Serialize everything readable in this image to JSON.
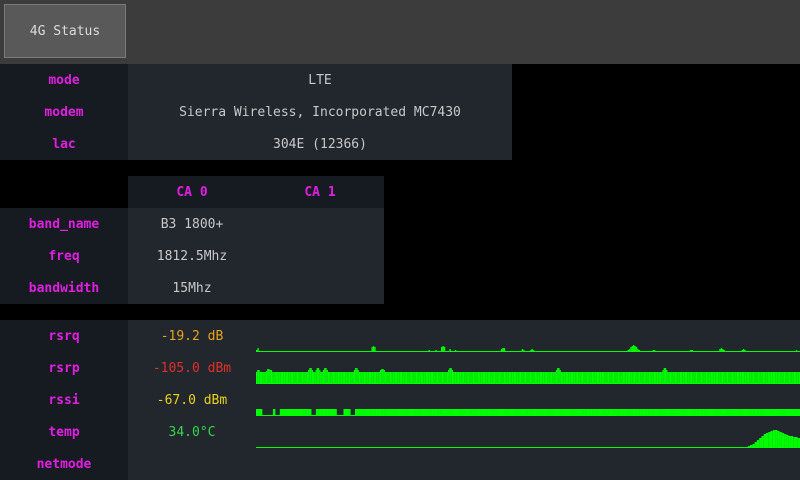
{
  "tab": {
    "label": "4G Status"
  },
  "info": {
    "mode": {
      "key": "mode",
      "value": "LTE"
    },
    "modem": {
      "key": "modem",
      "value": "Sierra Wireless, Incorporated MC7430"
    },
    "lac": {
      "key": "lac",
      "value": "304E (12366)"
    }
  },
  "ca": {
    "headers": [
      "CA 0",
      "CA 1"
    ],
    "rows": [
      {
        "key": "band_name",
        "ca0": "B3 1800+",
        "ca1": ""
      },
      {
        "key": "freq",
        "ca0": "1812.5Mhz",
        "ca1": ""
      },
      {
        "key": "bandwidth",
        "ca0": "15Mhz",
        "ca1": ""
      }
    ]
  },
  "signal": {
    "rsrq": {
      "key": "rsrq",
      "value": "-19.2 dB",
      "color": "#e8a31a"
    },
    "rsrp": {
      "key": "rsrp",
      "value": "-105.0 dBm",
      "color": "#e0302a"
    },
    "rssi": {
      "key": "rssi",
      "value": "-67.0 dBm",
      "color": "#e8d21a"
    },
    "temp": {
      "key": "temp",
      "value": "34.0°C",
      "color": "#36d648"
    },
    "netmode": {
      "key": "netmode",
      "value": ""
    }
  },
  "graph_color": "#00ff00",
  "history": {
    "rsrq": [
      2,
      4,
      1,
      0,
      0,
      0,
      0,
      0,
      0,
      0,
      0,
      0,
      0,
      1,
      0,
      0,
      0,
      0,
      0,
      0,
      0,
      0,
      0,
      0,
      0,
      0,
      0,
      0,
      0,
      0,
      0,
      0,
      0,
      0,
      0,
      0,
      1,
      0,
      0,
      0,
      0,
      0,
      0,
      0,
      0,
      0,
      0,
      0,
      1,
      0,
      0,
      0,
      0,
      0,
      0,
      0,
      0,
      0,
      0,
      0,
      0,
      0,
      0,
      0,
      0,
      0,
      0,
      1,
      0,
      0,
      0,
      0,
      0,
      0,
      0,
      0,
      0,
      0,
      0,
      0,
      0,
      0,
      0,
      5,
      6,
      5,
      0,
      0,
      0,
      0,
      0,
      0,
      1,
      0,
      0,
      0,
      0,
      0,
      0,
      0,
      0,
      0,
      0,
      0,
      0,
      1,
      0,
      0,
      0,
      0,
      0,
      0,
      0,
      0,
      0,
      0,
      0,
      0,
      0,
      0,
      0,
      0,
      0,
      0,
      2,
      0,
      0,
      0,
      0,
      2,
      1,
      0,
      0,
      5,
      6,
      5,
      0,
      0,
      0,
      3,
      0,
      0,
      0,
      2,
      1,
      0,
      0,
      0,
      0,
      0,
      0,
      0,
      0,
      0,
      0,
      0,
      0,
      1,
      1,
      1,
      0,
      0,
      0,
      0,
      0,
      0,
      0,
      0,
      0,
      0,
      0,
      0,
      0,
      0,
      0,
      0,
      3,
      4,
      4,
      1,
      0,
      0,
      0,
      0,
      0,
      1,
      0,
      0,
      0,
      0,
      0,
      3,
      2,
      1,
      0,
      0,
      0,
      2,
      3,
      2,
      1,
      0,
      0,
      0,
      1,
      0,
      0,
      0,
      0,
      0,
      0,
      0,
      0,
      0,
      0,
      0,
      0,
      0,
      0,
      0,
      0,
      0,
      0,
      0,
      0,
      0,
      0,
      0,
      0,
      0,
      0,
      0,
      0,
      0,
      0,
      0,
      0,
      0,
      0,
      0,
      0,
      0,
      0,
      0,
      0,
      0,
      0,
      0,
      0,
      0,
      0,
      0,
      0,
      0,
      0,
      0,
      0,
      0,
      0,
      0,
      0,
      0,
      0,
      0,
      0,
      1,
      1,
      2,
      3,
      5,
      6,
      7,
      6,
      5,
      3,
      2,
      1,
      0,
      0,
      0,
      0,
      0,
      0,
      0,
      0,
      2,
      2,
      1,
      0,
      0,
      0,
      0,
      0,
      0,
      0,
      0,
      0,
      0,
      0,
      0,
      0,
      0,
      0,
      0,
      0,
      0,
      0,
      0,
      0,
      0,
      0,
      1,
      2,
      2,
      1,
      0,
      0,
      0,
      0,
      0,
      0,
      0,
      0,
      0,
      1,
      0,
      0,
      0,
      0,
      0,
      0,
      0,
      0,
      3,
      4,
      3,
      2,
      1,
      0,
      0,
      0,
      0,
      0,
      0,
      0,
      0,
      0,
      0,
      0,
      2,
      3,
      2,
      1,
      0,
      0,
      0,
      0,
      0,
      0,
      0,
      0,
      0,
      0,
      0,
      0,
      0,
      0,
      0,
      0,
      0,
      0,
      0,
      0,
      0,
      0,
      0,
      0,
      0,
      0,
      0,
      0,
      0,
      0,
      0,
      0,
      0,
      0,
      1,
      2,
      1,
      0
    ],
    "rsrp": [
      12,
      14,
      14,
      12,
      12,
      12,
      12,
      12,
      13,
      15,
      15,
      14,
      14,
      12,
      12,
      12,
      12,
      12,
      12,
      12,
      12,
      12,
      12,
      12,
      12,
      12,
      12,
      12,
      12,
      12,
      12,
      12,
      12,
      12,
      12,
      12,
      12,
      12,
      12,
      12,
      12,
      12,
      14,
      16,
      16,
      14,
      12,
      12,
      14,
      16,
      16,
      14,
      12,
      12,
      14,
      16,
      16,
      14,
      12,
      12,
      12,
      12,
      12,
      12,
      12,
      12,
      12,
      12,
      12,
      12,
      12,
      12,
      12,
      12,
      12,
      12,
      12,
      12,
      12,
      14,
      16,
      16,
      14,
      12,
      12,
      12,
      12,
      12,
      12,
      12,
      12,
      12,
      12,
      12,
      12,
      12,
      12,
      12,
      12,
      12,
      14,
      15,
      15,
      14,
      12,
      12,
      12,
      12,
      12,
      12,
      12,
      12,
      12,
      12,
      12,
      12,
      12,
      12,
      12,
      12,
      12,
      12,
      12,
      12,
      12,
      12,
      12,
      12,
      12,
      12,
      12,
      12,
      12,
      12,
      12,
      12,
      12,
      12,
      12,
      12,
      12,
      12,
      12,
      12,
      12,
      12,
      12,
      12,
      12,
      12,
      12,
      12,
      12,
      12,
      12,
      14,
      16,
      16,
      14,
      12,
      12,
      12,
      12,
      12,
      12,
      12,
      12,
      12,
      12,
      12,
      12,
      12,
      12,
      12,
      12,
      12,
      12,
      12,
      12,
      12,
      12,
      12,
      12,
      12,
      12,
      12,
      12,
      12,
      12,
      12,
      12,
      12,
      12,
      12,
      12,
      12,
      12,
      12,
      12,
      12,
      12,
      12,
      12,
      12,
      12,
      12,
      12,
      12,
      12,
      12,
      12,
      12,
      12,
      12,
      12,
      12,
      12,
      12,
      12,
      12,
      12,
      12,
      12,
      12,
      12,
      12,
      12,
      12,
      12,
      12,
      12,
      12,
      12,
      12,
      12,
      12,
      12,
      12,
      12,
      12,
      12,
      12,
      14,
      16,
      16,
      14,
      12,
      12,
      12,
      12,
      12,
      12,
      12,
      12,
      12,
      12,
      12,
      12,
      12,
      12,
      12,
      12,
      12,
      12,
      12,
      12,
      12,
      12,
      12,
      12,
      12,
      12,
      12,
      12,
      12,
      12,
      12,
      12,
      12,
      12,
      12,
      12,
      12,
      12,
      12,
      12,
      12,
      12,
      12,
      12,
      12,
      12,
      12,
      12,
      12,
      12,
      12,
      12,
      12,
      12,
      12,
      12,
      12,
      12,
      12,
      12,
      12,
      12,
      12,
      12,
      12,
      12,
      12,
      12,
      12,
      12,
      12,
      12,
      12,
      12,
      12,
      12,
      12,
      12,
      12,
      12,
      12,
      12,
      14,
      16,
      16,
      14,
      12,
      12,
      12,
      12,
      12,
      12,
      12,
      12,
      12,
      12,
      12,
      12,
      12,
      12,
      12,
      12,
      12,
      12,
      12,
      12,
      12,
      12,
      12,
      12,
      12,
      12,
      12,
      12,
      12,
      12,
      12,
      12,
      12,
      12,
      12,
      12,
      12,
      12,
      12,
      12,
      12,
      12,
      12,
      12,
      12,
      12,
      12,
      12,
      12,
      12,
      12,
      12,
      12,
      12,
      12,
      12,
      12,
      12,
      12,
      12,
      12,
      12,
      12,
      12,
      12,
      12,
      12,
      12,
      12,
      12,
      12,
      12,
      12,
      12,
      12,
      12,
      12,
      12,
      12,
      12,
      12,
      12,
      12,
      12,
      12,
      12,
      12,
      12,
      12,
      12,
      12,
      12,
      12,
      12,
      12,
      12,
      12,
      12,
      12,
      12,
      12,
      12,
      12,
      12,
      12,
      12,
      12
    ],
    "rssi": [
      7,
      7,
      7,
      7,
      7,
      7,
      7,
      7,
      1,
      1,
      1,
      1,
      1,
      1,
      1,
      1,
      1,
      1,
      1,
      1,
      1,
      1,
      7,
      7,
      7,
      1,
      1,
      1,
      1,
      1,
      1,
      7,
      7,
      7,
      7,
      7,
      7,
      7,
      7,
      7,
      7,
      7,
      7,
      7,
      7,
      7,
      7,
      7,
      7,
      7,
      7,
      7,
      7,
      7,
      7,
      7,
      7,
      7,
      7,
      7,
      7,
      7,
      7,
      7,
      7,
      7,
      7,
      7,
      7,
      7,
      7,
      7,
      1,
      1,
      1,
      1,
      1,
      1,
      7,
      7,
      7,
      7,
      7,
      7,
      7,
      7,
      7,
      7,
      7,
      7,
      7,
      7,
      7,
      7,
      7,
      7,
      7,
      7,
      7,
      7,
      7,
      7,
      7,
      7,
      7,
      1,
      1,
      1,
      1,
      1,
      1,
      1,
      1,
      1,
      7,
      7,
      7,
      7,
      7,
      7,
      7,
      7,
      7,
      1,
      1,
      1,
      1,
      1,
      1,
      7,
      7,
      7,
      7,
      7,
      7,
      7,
      7,
      7,
      7,
      7,
      7,
      7,
      7,
      7,
      7,
      7,
      7,
      7,
      7,
      7,
      7,
      7,
      7,
      7,
      7,
      7,
      7,
      7,
      7,
      7,
      7,
      7,
      7,
      7,
      7,
      7,
      7,
      7,
      7,
      7,
      7,
      7,
      7,
      7,
      7,
      7,
      7,
      7,
      7,
      7,
      7,
      7,
      7,
      7,
      7,
      7,
      7,
      7,
      7,
      7,
      7,
      7,
      7,
      7,
      7,
      7,
      7,
      7,
      7,
      7,
      7,
      7,
      7,
      7,
      7,
      7,
      7,
      7,
      7,
      7,
      7,
      7,
      7,
      7,
      7,
      7,
      7,
      7,
      7,
      7,
      7,
      7,
      7,
      7,
      7,
      7,
      7,
      7,
      7,
      7,
      7,
      7,
      7,
      7,
      7,
      7,
      7,
      7,
      7,
      7,
      7,
      7,
      7,
      7,
      7,
      7,
      7,
      7,
      7,
      7,
      7,
      7,
      7,
      7,
      7,
      7,
      7,
      7,
      7,
      7,
      7,
      7,
      7,
      7,
      7,
      7,
      7,
      7,
      7,
      7,
      7,
      7,
      7,
      7,
      7,
      7,
      7,
      7,
      7,
      7,
      7,
      7,
      7,
      7,
      7,
      7,
      7,
      7,
      7,
      7,
      7,
      7,
      7,
      7,
      7,
      7,
      7,
      7,
      7,
      7,
      7,
      7,
      7,
      7,
      7,
      7,
      7,
      7,
      7,
      7,
      7,
      7,
      7,
      7,
      7,
      7,
      7,
      7,
      7,
      7,
      7,
      7,
      7,
      7,
      7,
      7,
      7,
      7,
      7,
      7,
      7,
      7,
      7,
      7,
      7,
      7,
      7,
      7,
      7,
      7,
      7,
      7,
      7,
      7,
      7,
      7,
      7,
      7,
      7,
      7,
      7,
      7,
      7,
      7,
      7,
      7,
      7,
      7,
      7,
      7,
      7,
      7,
      7,
      7,
      7,
      7,
      7,
      7,
      7,
      7,
      7,
      7,
      7,
      7,
      7,
      7,
      7,
      7,
      7,
      7,
      7,
      7,
      7,
      7,
      7,
      7,
      7,
      7,
      7,
      7,
      7,
      7,
      7,
      7,
      7,
      7,
      7,
      7,
      7,
      7,
      7,
      7,
      7,
      7,
      7,
      7,
      7,
      7,
      7,
      7,
      7,
      7,
      7,
      7,
      7,
      7,
      7,
      7,
      7,
      7,
      7,
      7,
      7,
      7,
      7,
      7,
      7,
      7,
      7,
      7,
      7,
      7,
      7,
      7,
      7,
      7,
      7,
      7,
      7,
      7,
      7,
      7,
      7,
      7,
      7,
      7,
      7,
      7,
      7,
      7,
      7,
      7,
      7,
      7,
      7,
      7,
      7,
      7,
      7,
      7,
      7,
      7,
      7,
      7,
      7,
      7,
      7,
      7,
      7,
      7,
      7,
      7,
      7,
      7,
      7,
      7,
      7,
      7,
      7,
      7,
      7,
      7,
      7,
      7,
      7,
      7,
      7,
      7,
      7,
      7,
      7,
      7,
      7,
      7,
      7,
      7,
      7,
      7,
      7,
      7,
      7,
      7,
      7,
      7,
      7,
      7,
      7,
      7,
      7,
      7,
      7,
      7,
      7,
      7,
      7,
      7,
      7,
      7,
      7,
      7,
      7,
      7,
      7,
      7,
      7,
      7,
      7,
      7,
      7,
      7,
      7,
      7,
      7,
      7,
      7,
      7,
      7,
      7,
      7,
      7,
      7,
      7,
      7,
      7,
      7,
      7,
      7,
      7,
      7,
      7,
      7,
      7,
      7,
      7,
      7,
      7,
      7,
      7,
      7,
      7,
      7,
      7,
      7,
      7,
      7,
      7,
      7,
      7,
      7,
      7,
      7,
      7,
      7,
      7,
      7,
      7,
      7,
      7,
      7,
      7,
      7,
      7,
      7,
      7,
      7,
      7,
      7,
      7,
      7,
      7,
      7,
      7,
      7,
      7,
      7,
      7,
      7,
      7,
      7,
      7,
      7,
      7,
      7,
      7,
      7,
      7,
      7,
      7,
      7,
      7,
      7,
      7,
      7,
      7,
      7,
      7,
      7,
      7,
      7,
      7,
      7,
      7,
      7,
      7,
      7,
      7,
      7,
      7,
      7,
      7,
      7,
      7,
      7,
      7,
      7,
      7,
      7,
      7,
      7,
      7,
      7,
      7,
      7,
      7,
      7,
      7,
      7,
      7,
      7,
      7,
      7,
      7,
      7,
      7,
      7,
      7,
      7,
      7,
      7,
      7,
      7,
      7,
      7,
      7,
      7,
      7,
      7,
      7,
      7,
      7,
      7,
      7,
      7,
      7,
      7,
      7,
      7,
      7,
      7,
      7,
      7,
      7,
      7,
      7,
      7,
      7,
      7,
      7,
      7,
      7,
      7,
      7,
      7,
      7,
      7,
      7,
      7,
      7,
      7,
      7,
      7,
      7,
      7,
      7,
      7,
      7,
      7,
      7,
      7
    ],
    "temp": [
      0
    ]
  }
}
